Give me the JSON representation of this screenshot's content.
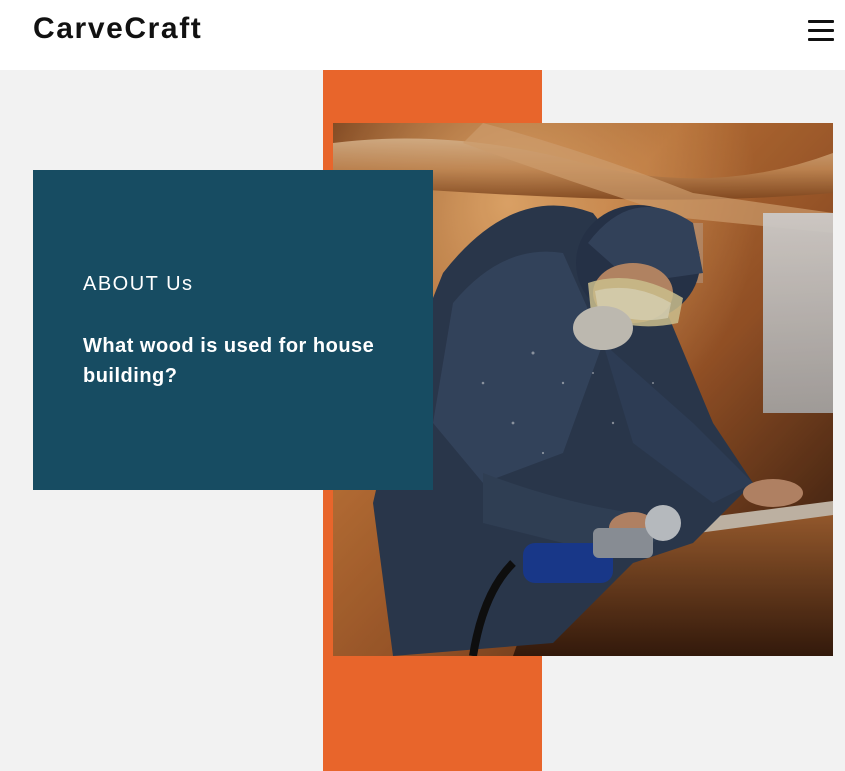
{
  "header": {
    "brand": "CarveCraft",
    "menu_icon": "hamburger-menu-icon"
  },
  "about": {
    "eyebrow": "ABOUT Us",
    "headline": "What wood is used for house building?"
  },
  "hero_image": {
    "icon": "craftsman-with-angle-grinder-photo"
  },
  "colors": {
    "accent": "#e8652b",
    "card": "#174c62",
    "page_bg": "#f2f2f2",
    "header_bg": "#ffffff",
    "text_dark": "#111111"
  }
}
